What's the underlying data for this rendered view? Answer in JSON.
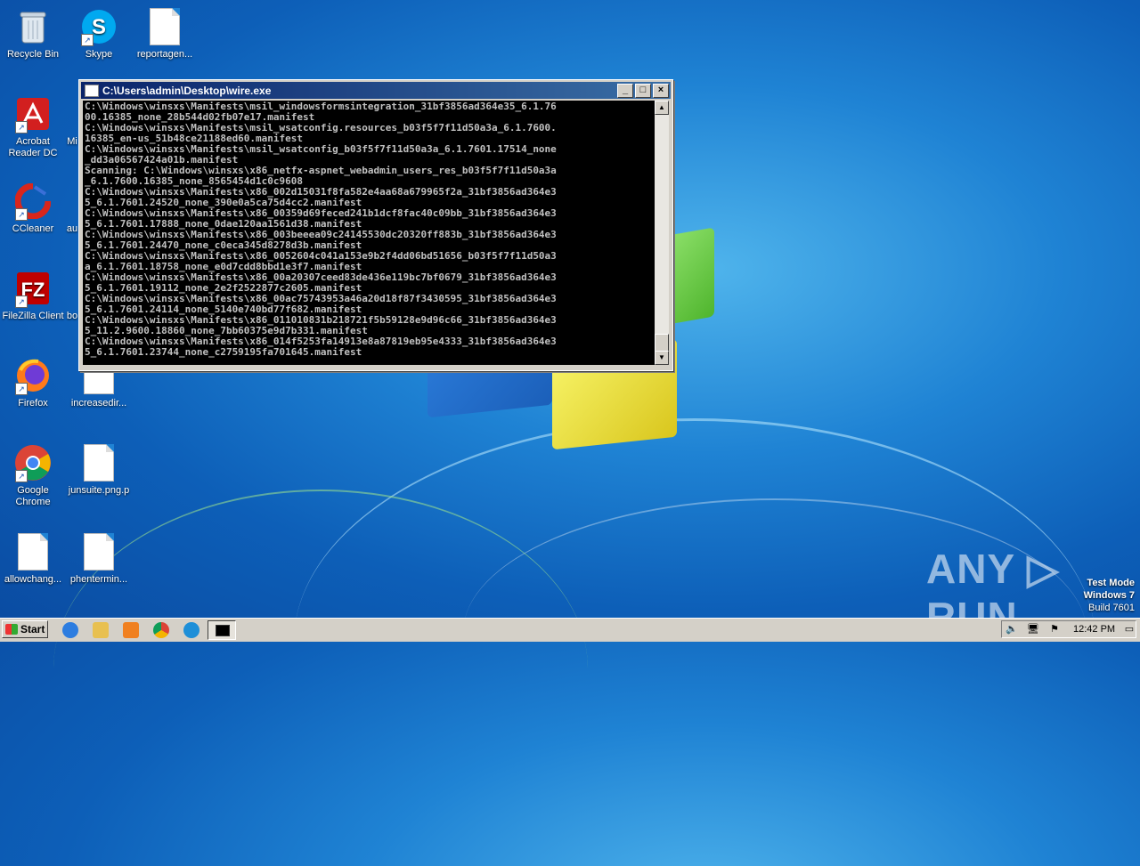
{
  "desktop": {
    "icons": [
      {
        "label": "Recycle Bin",
        "icon": "recycle-bin-icon"
      },
      {
        "label": "Skype",
        "icon": "skype-icon"
      },
      {
        "label": "reportagen...",
        "icon": "file-icon"
      },
      {
        "label": "Acrobat Reader DC",
        "icon": "acrobat-icon"
      },
      {
        "label": "Mi",
        "icon": "word-icon"
      },
      {
        "label": "CCleaner",
        "icon": "ccleaner-icon"
      },
      {
        "label": "au",
        "icon": "file-icon"
      },
      {
        "label": "FileZilla Client",
        "icon": "filezilla-icon"
      },
      {
        "label": "bo",
        "icon": "file-icon"
      },
      {
        "label": "Firefox",
        "icon": "firefox-icon"
      },
      {
        "label": "increasedir...",
        "icon": "file-icon"
      },
      {
        "label": "Google Chrome",
        "icon": "chrome-icon"
      },
      {
        "label": "junsuite.png.p",
        "icon": "file-icon"
      },
      {
        "label": "allowchang...",
        "icon": "file-icon"
      },
      {
        "label": "phentermin...",
        "icon": "file-icon"
      }
    ]
  },
  "console_window": {
    "title": "C:\\Users\\admin\\Desktop\\wire.exe",
    "minimize_glyph": "_",
    "maximize_glyph": "□",
    "close_glyph": "×",
    "output": "C:\\Windows\\winsxs\\Manifests\\msil_windowsformsintegration_31bf3856ad364e35_6.1.7600.16385_none_28b544d02fb07e17.manifest\nC:\\Windows\\winsxs\\Manifests\\msil_wsatconfig.resources_b03f5f7f11d50a3a_6.1.7600.16385_en-us_51b48ce21188ed60.manifest\nC:\\Windows\\winsxs\\Manifests\\msil_wsatconfig_b03f5f7f11d50a3a_6.1.7601.17514_none_dd3a06567424a01b.manifest\nScanning: C:\\Windows\\winsxs\\x86_netfx-aspnet_webadmin_users_res_b03f5f7f11d50a3a_6.1.7600.16385_none_8565454d1c0c9608\nC:\\Windows\\winsxs\\Manifests\\x86_002d15031f8fa582e4aa68a679965f2a_31bf3856ad364e35_6.1.7601.24520_none_390e0a5ca75d4cc2.manifest\nC:\\Windows\\winsxs\\Manifests\\x86_00359d69feced241b1dcf8fac40c09bb_31bf3856ad364e35_6.1.7601.17888_none_0dae120aa1561d38.manifest\nC:\\Windows\\winsxs\\Manifests\\x86_003beeea09c24145530dc20320ff883b_31bf3856ad364e35_6.1.7601.24470_none_c0eca345d8278d3b.manifest\nC:\\Windows\\winsxs\\Manifests\\x86_0052604c041a153e9b2f4dd06bd51656_b03f5f7f11d50a3a_6.1.7601.18758_none_e0d7cdd8bbd1e3f7.manifest\nC:\\Windows\\winsxs\\Manifests\\x86_00a20307ceed83de436e119bc7bf0679_31bf3856ad364e35_6.1.7601.19112_none_2e2f2522877c2605.manifest\nC:\\Windows\\winsxs\\Manifests\\x86_00ac75743953a46a20d18f87f3430595_31bf3856ad364e35_6.1.7601.24114_none_5140e740bd77f682.manifest\nC:\\Windows\\winsxs\\Manifests\\x86_011010831b218721f5b59128e9d96c66_31bf3856ad364e35_11.2.9600.18860_none_7bb60375e9d7b331.manifest\nC:\\Windows\\winsxs\\Manifests\\x86_014f5253fa14913e8a87819eb95e4333_31bf3856ad364e35_6.1.7601.23744_none_c2759195fa701645.manifest"
  },
  "watermark": {
    "text": "ANY ▷ RUN"
  },
  "test_mode": {
    "line1": "Test Mode",
    "line2": "Windows 7",
    "line3": "Build 7601"
  },
  "taskbar": {
    "start_label": "Start",
    "clock": "12:42 PM",
    "quick_launch": [
      "internet-explorer-icon",
      "explorer-icon",
      "media-player-icon",
      "chrome-icon",
      "edge-icon"
    ]
  }
}
